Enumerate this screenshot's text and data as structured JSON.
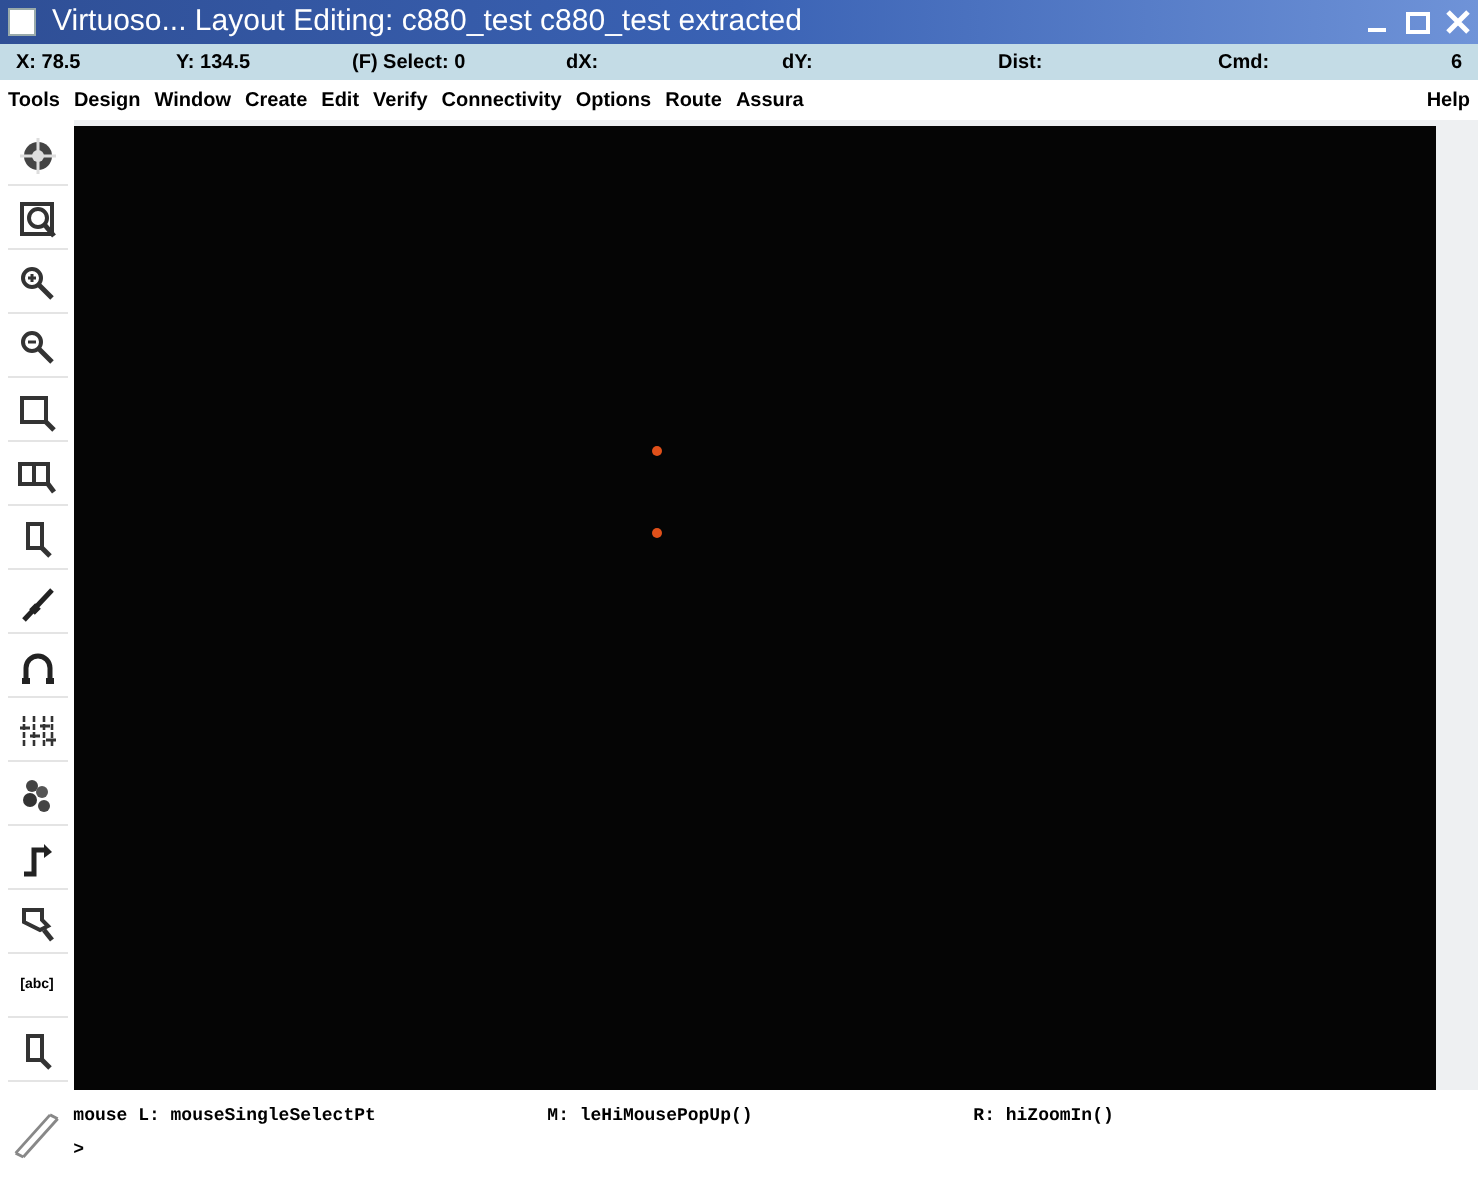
{
  "window": {
    "title": "Virtuoso... Layout Editing: c880_test c880_test extracted"
  },
  "coordinate_bar": {
    "fields": [
      "X: 78.5",
      "Y: 134.5",
      "(F) Select: 0",
      "dX:",
      "dY:",
      "Dist:",
      "Cmd:"
    ],
    "count": "6"
  },
  "menu_bar": {
    "items": [
      "Tools",
      "Design",
      "Window",
      "Create",
      "Edit",
      "Verify",
      "Connectivity",
      "Options",
      "Route",
      "Assura"
    ],
    "help": "Help"
  },
  "toolbar": [
    {
      "kind": "target"
    },
    {
      "kind": "zoom-fit"
    },
    {
      "kind": "zoom-in"
    },
    {
      "kind": "zoom-out"
    },
    {
      "kind": "rect"
    },
    {
      "kind": "rects"
    },
    {
      "kind": "mag"
    },
    {
      "kind": "path"
    },
    {
      "kind": "arc"
    },
    {
      "kind": "bars"
    },
    {
      "kind": "cluster"
    },
    {
      "kind": "step"
    },
    {
      "kind": "poly"
    },
    {
      "kind": "label",
      "label": "[abc]"
    },
    {
      "kind": "mag"
    }
  ],
  "canvas": {
    "pins": [
      {
        "color": "#e0501a"
      },
      {
        "color": "#e0501a"
      }
    ]
  },
  "status_bar": {
    "left": "mouse L: mouseSingleSelectPt",
    "middle": "M: leHiMousePopUp()",
    "right": "R: hiZoomIn()",
    "prompt": ">"
  }
}
